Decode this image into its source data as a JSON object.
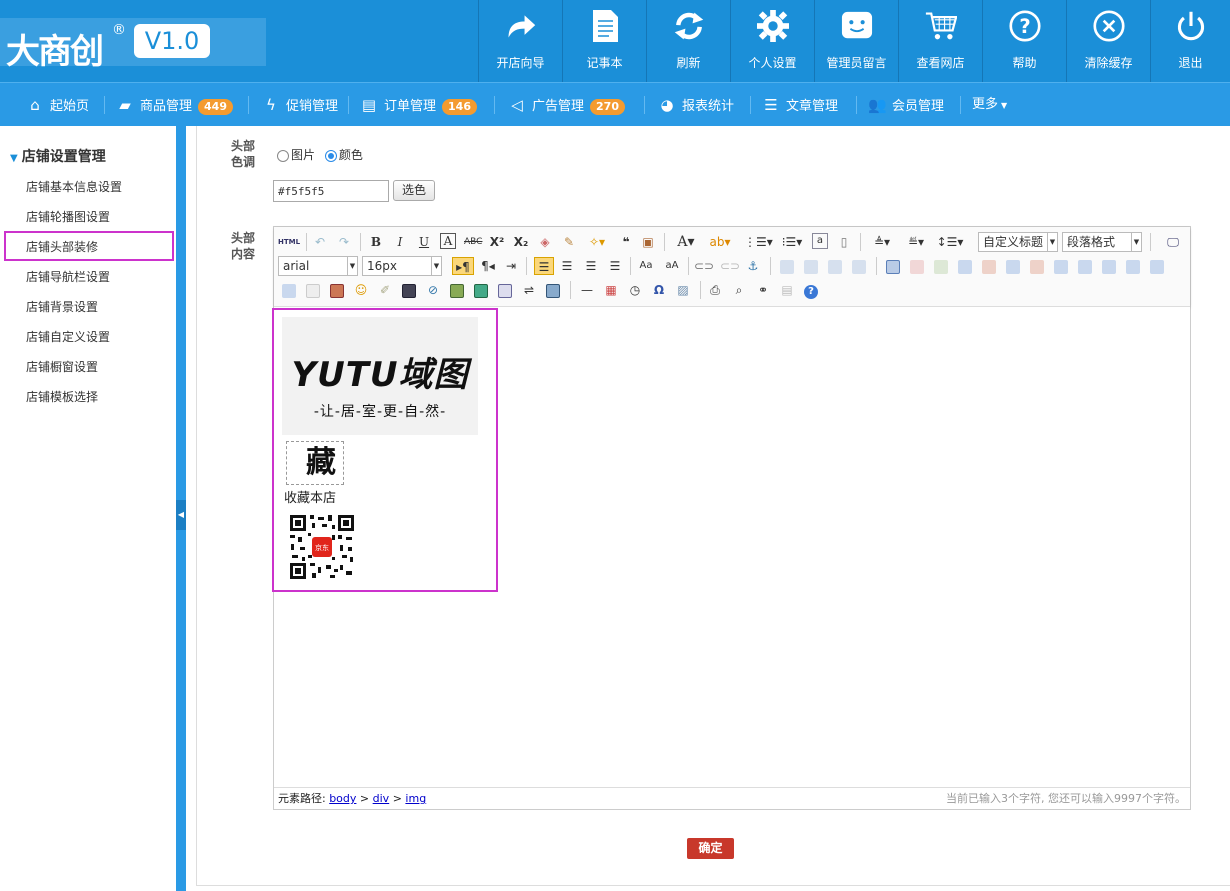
{
  "app": {
    "logo_text": "大商创",
    "logo_reg": "®",
    "version": "V1.0"
  },
  "top_buttons": [
    {
      "label": "开店向导",
      "icon": "share-arrow-icon"
    },
    {
      "label": "记事本",
      "icon": "notepad-icon"
    },
    {
      "label": "刷新",
      "icon": "refresh-icon"
    },
    {
      "label": "个人设置",
      "icon": "gear-icon"
    },
    {
      "label": "管理员留言",
      "icon": "chat-bubble-icon"
    },
    {
      "label": "查看网店",
      "icon": "shopping-cart-icon"
    },
    {
      "label": "帮助",
      "icon": "help-icon"
    },
    {
      "label": "清除缓存",
      "icon": "close-circle-icon"
    },
    {
      "label": "退出",
      "icon": "power-icon"
    }
  ],
  "nav": {
    "home": "起始页",
    "goods": "商品管理",
    "goods_badge": "449",
    "promo": "促销管理",
    "orders": "订单管理",
    "orders_badge": "146",
    "ads": "广告管理",
    "ads_badge": "270",
    "reports": "报表统计",
    "articles": "文章管理",
    "members": "会员管理",
    "more": "更多"
  },
  "sidebar": {
    "title": "店铺设置管理",
    "items": [
      "店铺基本信息设置",
      "店铺轮播图设置",
      "店铺头部装修",
      "店铺导航栏设置",
      "店铺背景设置",
      "店铺自定义设置",
      "店铺橱窗设置",
      "店铺模板选择"
    ]
  },
  "form": {
    "header_color_label_1": "头部",
    "header_color_label_2": "色调",
    "radio_image": "图片",
    "radio_color": "颜色",
    "selected": "颜色",
    "color_value": "#f5f5f5",
    "pick_button": "选色",
    "header_content_label_1": "头部",
    "header_content_label_2": "内容",
    "submit": "确定"
  },
  "editor": {
    "html_btn": "HTML",
    "font_family": "arial",
    "font_size": "16px",
    "heading_select": "自定义标题",
    "paragraph_select": "段落格式",
    "content": {
      "logo_text": "YUTU域图",
      "slogan": "-让-居-室-更-自-然-",
      "fav_char": "藏",
      "fav_label": "收藏本店",
      "qr_center": "京东"
    },
    "status": {
      "path_prefix": "元素路径: ",
      "path_body": "body",
      "path_div": "div",
      "path_img": "img",
      "sep": " > ",
      "count": "当前已输入3个字符, 您还可以输入9997个字符。"
    }
  },
  "colors": {
    "topbar": "#1b8fd8",
    "navbar": "#2a9ae5",
    "badge": "#f49b2f",
    "highlight": "#cc33cc",
    "submit": "#c8382b"
  }
}
